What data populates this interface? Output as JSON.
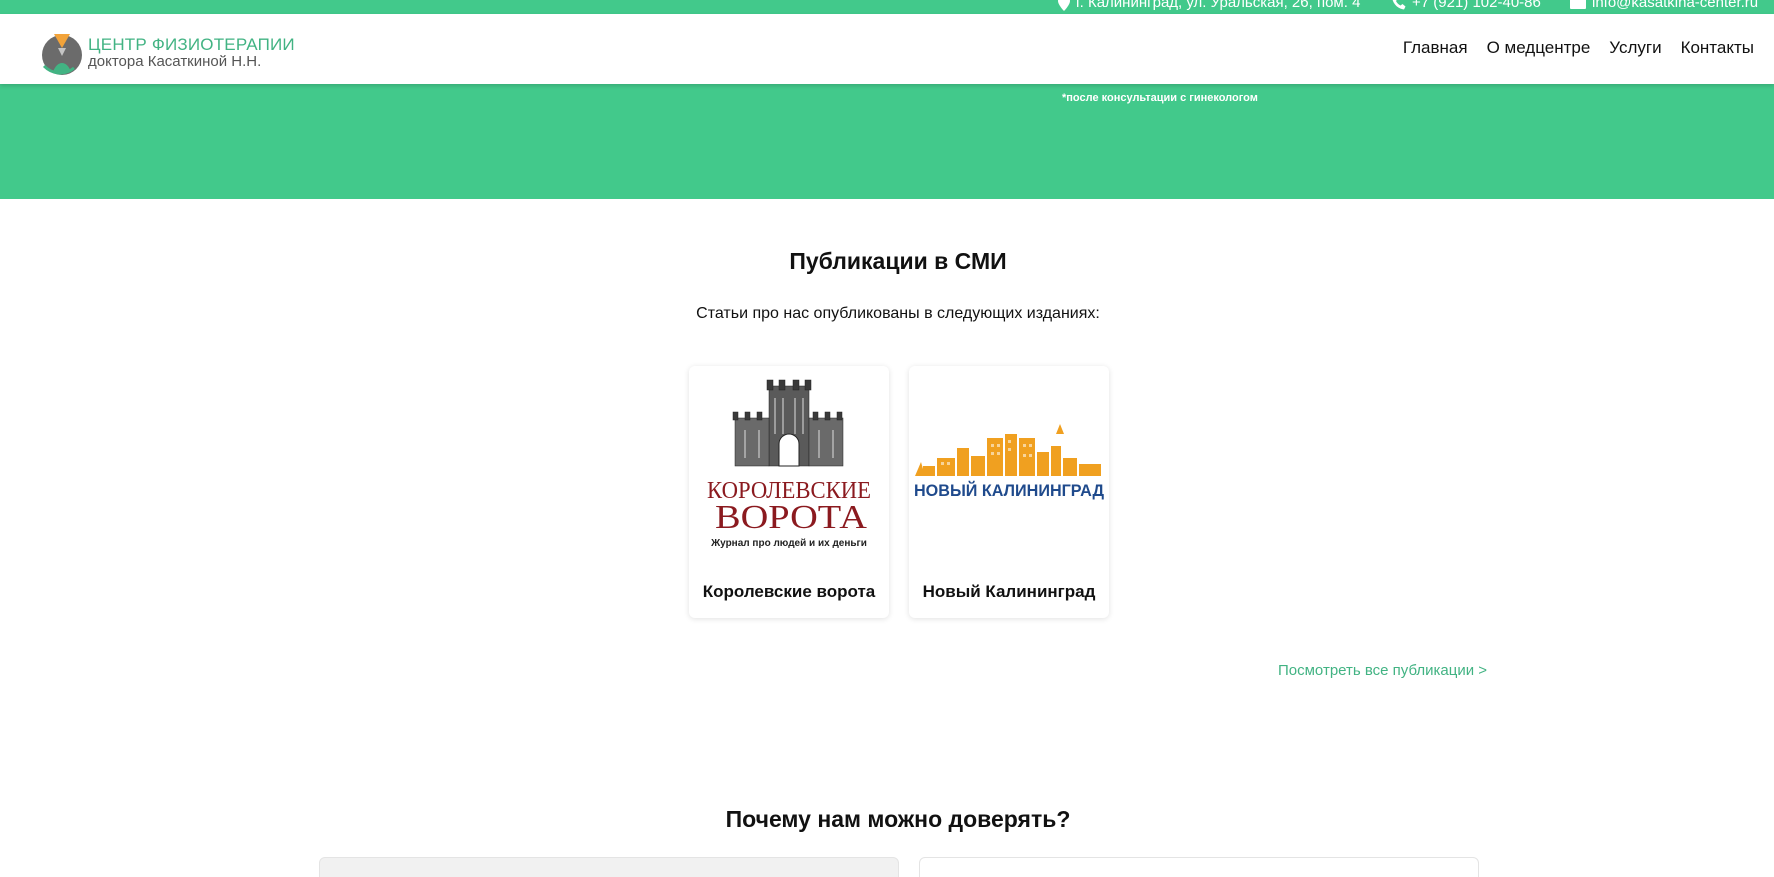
{
  "topbar": {
    "address": "г. Калининград, ул. Уральская, 26, пом. 4",
    "phone": "+7 (921) 102-40-86",
    "email": "info@kasatkina-center.ru",
    "icons": [
      "map-pin-icon",
      "phone-icon",
      "mail-icon"
    ]
  },
  "header": {
    "logo_line1": "ЦЕНТР ФИЗИОТЕРАПИИ",
    "logo_line2": "доктора Касаткиной Н.Н.",
    "nav": [
      "Главная",
      "О медцентре",
      "Услуги",
      "Контакты"
    ]
  },
  "hero": {
    "note": "*после консультации с гинекологом"
  },
  "publications": {
    "title": "Публикации в СМИ",
    "subtitle": "Статьи про нас опубликованы в следующих изданиях:",
    "cards": [
      {
        "name": "Королевские ворота",
        "logo_line1": "КОРОЛЕВСКИЕ",
        "logo_line2": "ВОРОТА",
        "logo_tagline": "Журнал про людей и их деньги"
      },
      {
        "name": "Новый Калининград",
        "logo_text": "НОВЫЙ КАЛИНИНГРАД"
      }
    ],
    "view_all": "Посмотреть все публикации >"
  },
  "trust": {
    "title": "Почему нам можно доверять?"
  },
  "colors": {
    "brand_green": "#42c98b",
    "link_green": "#42b383",
    "kv_red": "#8b1a1f",
    "nk_blue": "#1f4a8c",
    "nk_orange": "#f0a020"
  }
}
